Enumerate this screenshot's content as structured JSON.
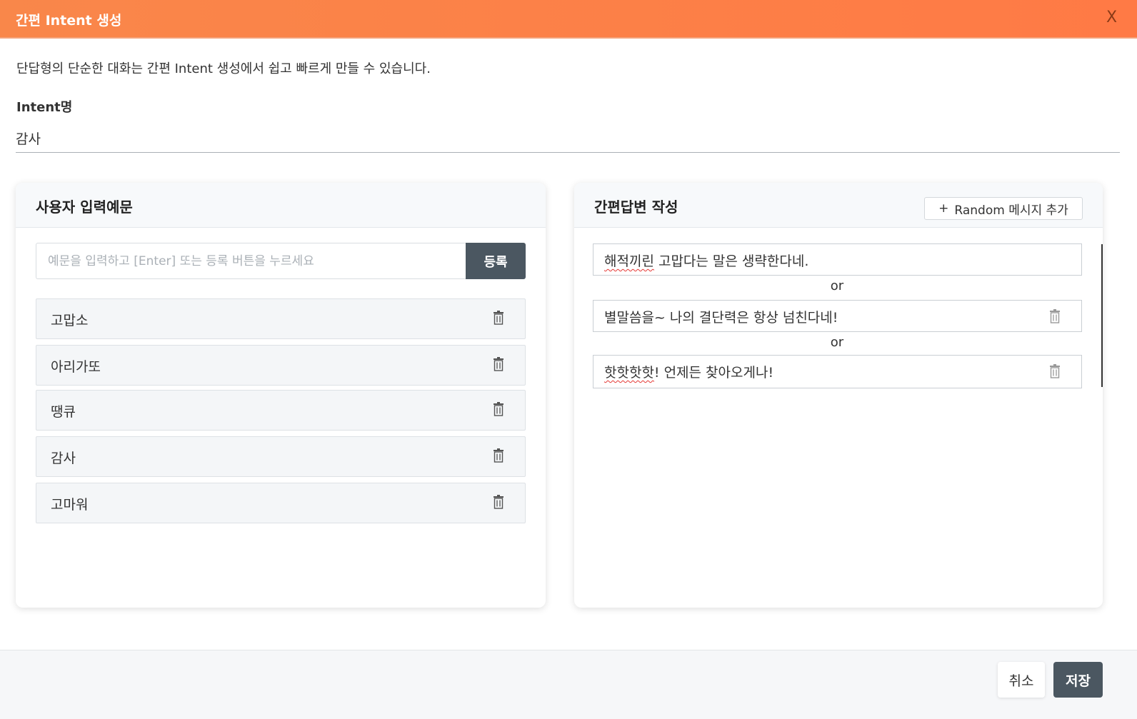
{
  "header": {
    "title": "간편 Intent 생성",
    "close_label": "X"
  },
  "description": "단답형의 단순한 대화는 간편 Intent 생성에서 쉽고 빠르게 만들 수 있습니다.",
  "intent": {
    "label": "Intent명",
    "value": "감사"
  },
  "examples": {
    "title": "사용자 입력예문",
    "placeholder": "예문을 입력하고 [Enter] 또는 등록 버튼을 누르세요",
    "register_label": "등록",
    "items": [
      "고맙소",
      "아리가또",
      "땡큐",
      "감사",
      "고마워"
    ]
  },
  "answers": {
    "title": "간편답변 작성",
    "random_button_label": "Random 메시지 추가",
    "random_button_icon": "+",
    "or_label": "or",
    "items": [
      {
        "pre": "",
        "underlined": "해적끼린",
        "post": " 고맙다는 말은 생략한다네."
      },
      {
        "pre": "",
        "underlined": "",
        "post": "별말씀을~ 나의 결단력은 항상 넘친다네!"
      },
      {
        "pre": "",
        "underlined": "핫핫핫핫",
        "post": "! 언제든 찾아오게나!"
      }
    ]
  },
  "footer": {
    "cancel_label": "취소",
    "save_label": "저장"
  },
  "colors": {
    "header": "#ff7a45",
    "dark_button": "#4b5761",
    "spell_underline": "#e53935"
  }
}
